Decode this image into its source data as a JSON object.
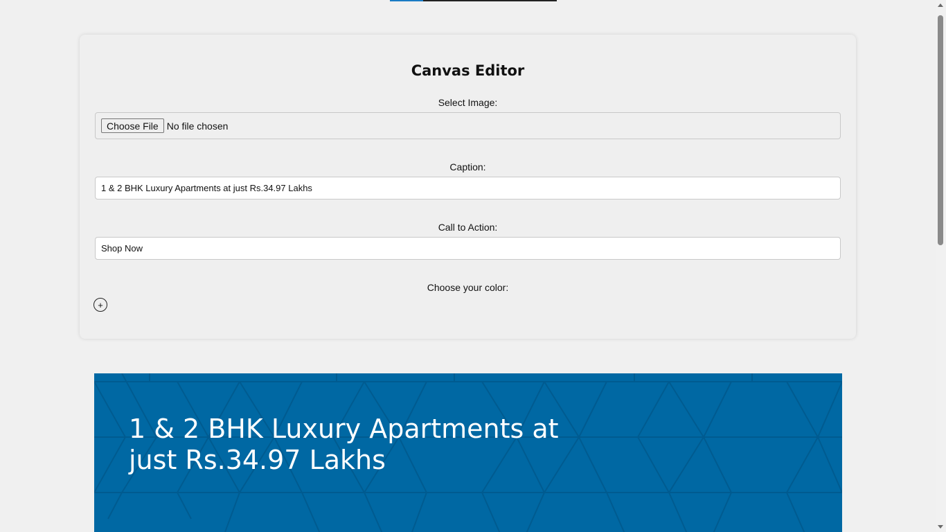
{
  "editor": {
    "title": "Canvas Editor",
    "image_label": "Select Image:",
    "file_button_label": "Choose File",
    "file_status": "No file chosen",
    "caption_label": "Caption:",
    "caption_value": "1 & 2 BHK Luxury Apartments at just Rs.34.97 Lakhs",
    "cta_label": "Call to Action:",
    "cta_value": "Shop Now",
    "color_label": "Choose your color:",
    "add_color_symbol": "+"
  },
  "preview": {
    "caption": "1 & 2 BHK Luxury Apartments at just Rs.34.97 Lakhs",
    "background_color": "#0068a3"
  },
  "colors": {
    "page_background": "#f0f0f0",
    "tab_accent": "#1a7bc4"
  },
  "icons": {
    "add_color": "plus-circle-icon"
  }
}
